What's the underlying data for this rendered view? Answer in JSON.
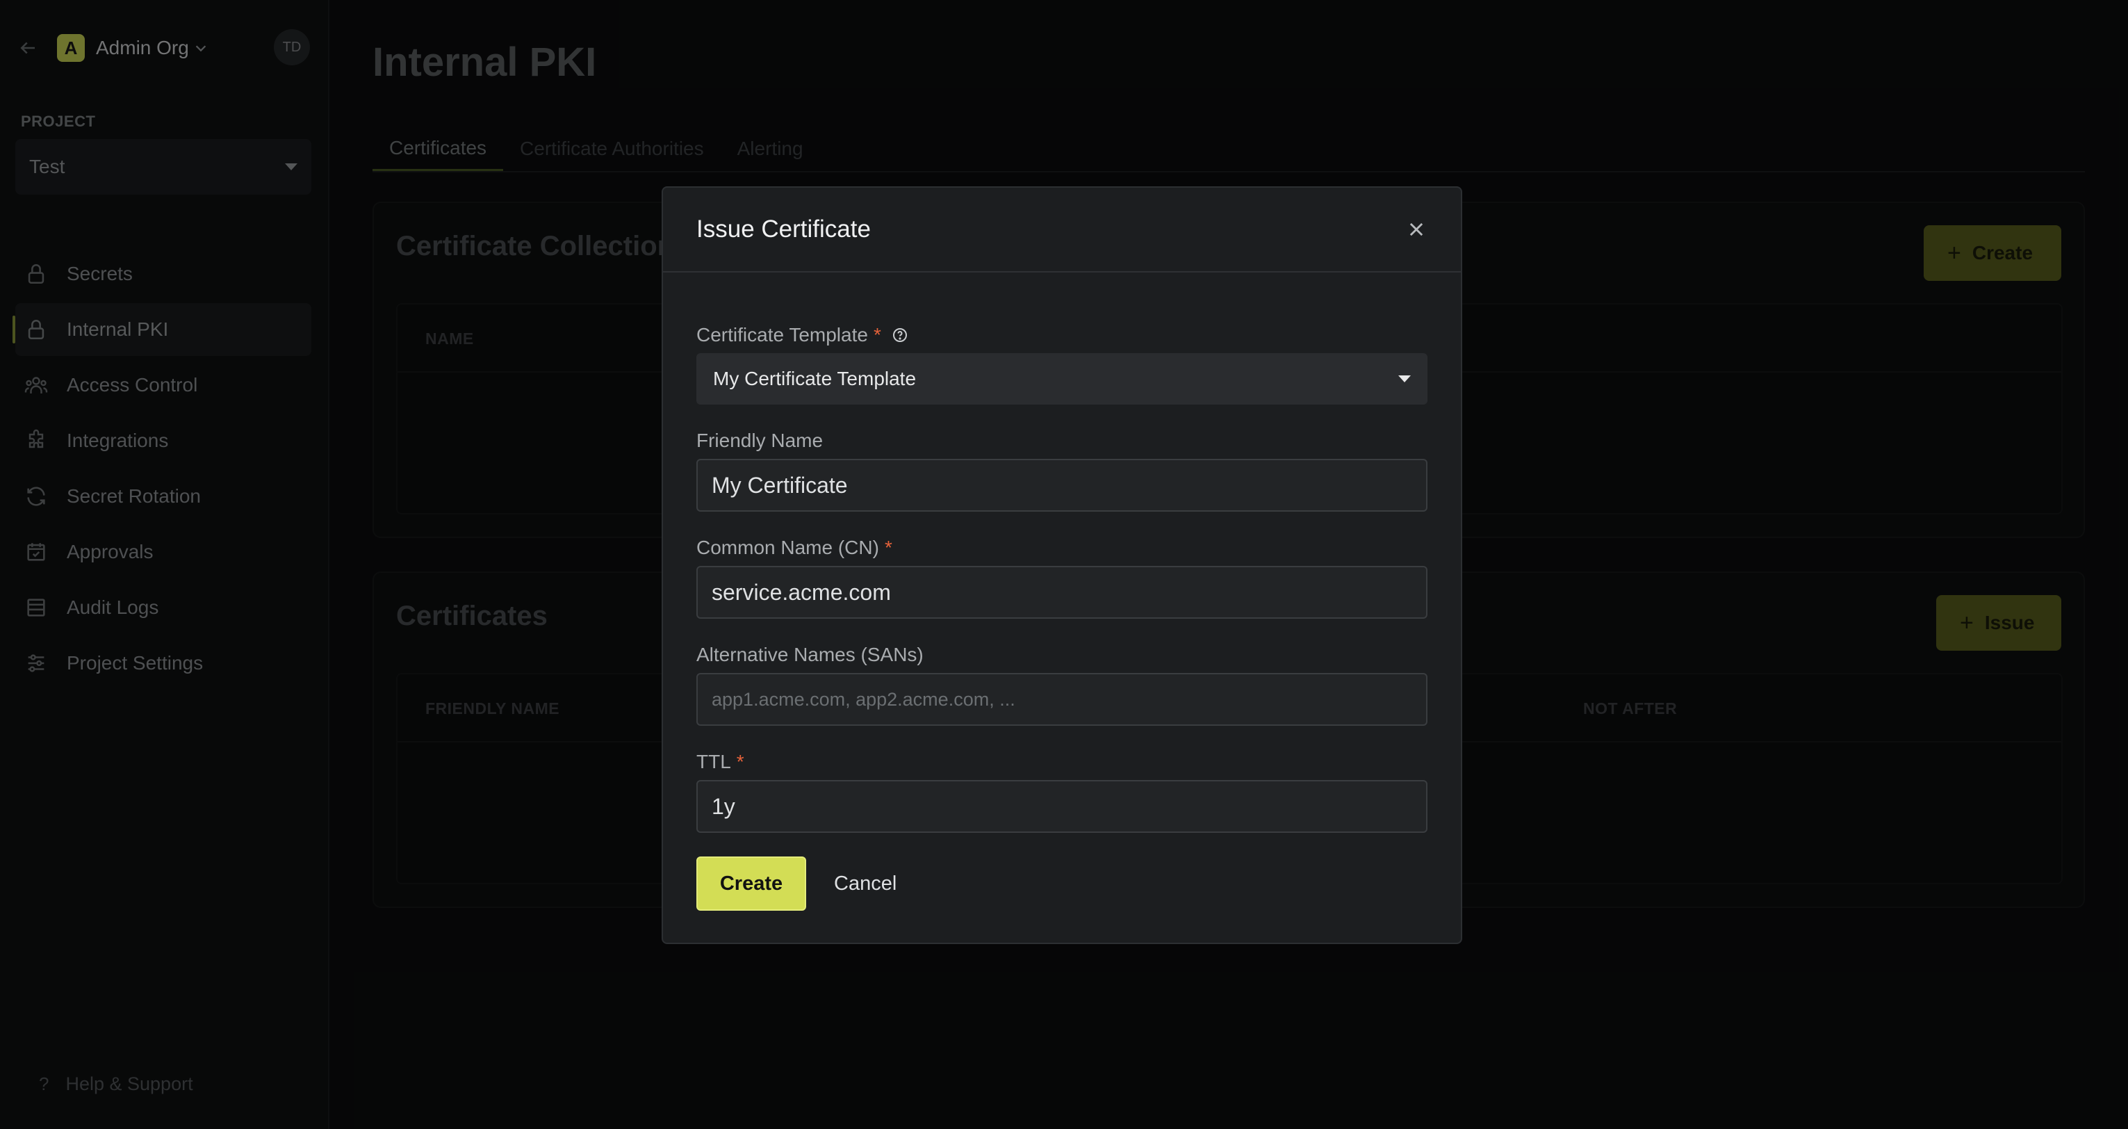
{
  "sidebar": {
    "org_badge": "A",
    "org_name": "Admin Org",
    "avatar": "TD",
    "project_label": "PROJECT",
    "project_value": "Test",
    "items": [
      {
        "label": "Secrets",
        "icon": "lock-icon"
      },
      {
        "label": "Internal PKI",
        "icon": "lock-icon",
        "active": true
      },
      {
        "label": "Access Control",
        "icon": "users-icon"
      },
      {
        "label": "Integrations",
        "icon": "puzzle-icon"
      },
      {
        "label": "Secret Rotation",
        "icon": "rotate-icon"
      },
      {
        "label": "Approvals",
        "icon": "checkbox-icon"
      },
      {
        "label": "Audit Logs",
        "icon": "list-icon"
      },
      {
        "label": "Project Settings",
        "icon": "sliders-icon"
      }
    ],
    "help": "Help & Support"
  },
  "main": {
    "title": "Internal PKI",
    "tabs": [
      "Certificates",
      "Certificate Authorities",
      "Alerting"
    ],
    "collections_card": {
      "title": "Certificate Collection",
      "button": "Create",
      "columns": [
        "NAME"
      ]
    },
    "certificates_card": {
      "title": "Certificates",
      "button": "Issue",
      "columns": [
        "FRIENDLY NAME",
        "NOT AFTER"
      ]
    }
  },
  "modal": {
    "title": "Issue Certificate",
    "template_label": "Certificate Template",
    "template_value": "My Certificate Template",
    "friendly_label": "Friendly Name",
    "friendly_value": "My Certificate",
    "cn_label": "Common Name (CN)",
    "cn_value": "service.acme.com",
    "sans_label": "Alternative Names (SANs)",
    "sans_placeholder": "app1.acme.com, app2.acme.com, ...",
    "ttl_label": "TTL",
    "ttl_value": "1y",
    "required_mark": "*",
    "create": "Create",
    "cancel": "Cancel"
  },
  "colors": {
    "accent": "#d3dd55",
    "required": "#e5623a",
    "modal_bg": "#1c1e20",
    "page_bg": "#0b0c0d"
  }
}
